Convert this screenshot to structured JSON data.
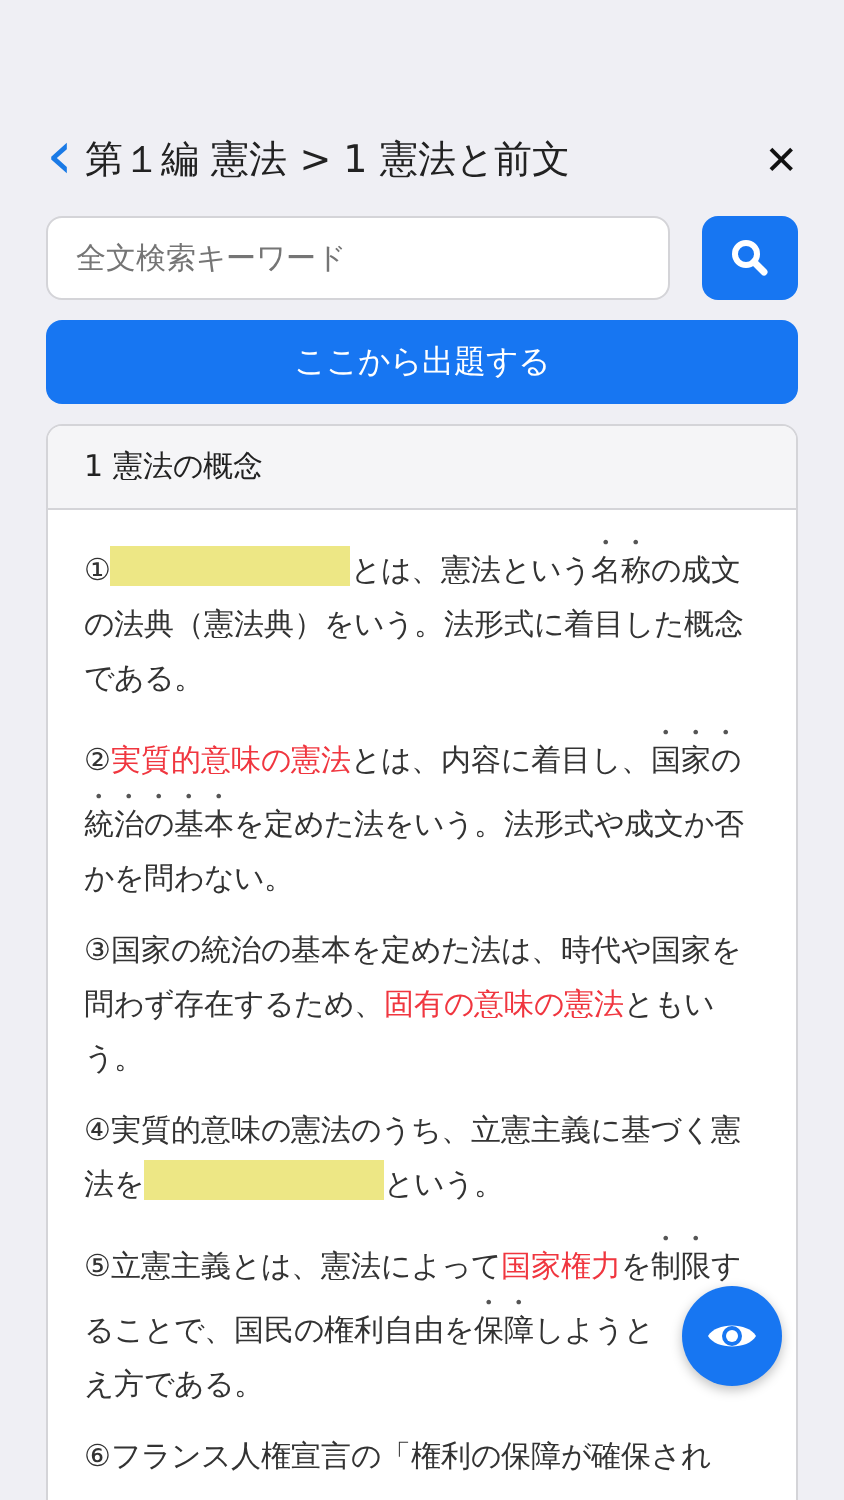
{
  "header": {
    "back": "‹",
    "title": "第１編 憲法 > 1 憲法と前文",
    "close": "✕"
  },
  "search": {
    "placeholder": "全文検索キーワード"
  },
  "start_button": "ここから出題する",
  "section": {
    "title": "1 憲法の概念",
    "paragraphs": [
      {
        "kind": "start",
        "segments": [
          {
            "kind": "text",
            "text": "①"
          },
          {
            "kind": "blank"
          },
          {
            "kind": "text",
            "text": "とは、憲法という"
          },
          {
            "kind": "dot",
            "text": "名称"
          },
          {
            "kind": "text",
            "text": "の成文の法典（憲法典）をいう。法形式に着目した概念である。"
          }
        ]
      },
      {
        "kind": "start",
        "segments": [
          {
            "kind": "text",
            "text": "②"
          },
          {
            "kind": "red",
            "text": "実質的意味の憲法"
          },
          {
            "kind": "text",
            "text": "とは、内容に着目し、"
          },
          {
            "kind": "dot",
            "text": "国家の統治の基本"
          },
          {
            "kind": "text",
            "text": "を定めた法をいう。法形式や成文か否かを問わない。"
          }
        ]
      },
      {
        "kind": "start",
        "segments": [
          {
            "kind": "text",
            "text": "③国家の統治の基本を定めた法は、時代や国家を問わず存在するため、"
          },
          {
            "kind": "red",
            "text": "固有の意味の憲法"
          },
          {
            "kind": "text",
            "text": "ともいう。"
          }
        ]
      },
      {
        "kind": "start",
        "segments": [
          {
            "kind": "text",
            "text": "④実質的意味の憲法のうち、立憲主義に基づく憲法を"
          },
          {
            "kind": "blank"
          },
          {
            "kind": "text",
            "text": "という。"
          }
        ]
      },
      {
        "kind": "start",
        "segments": [
          {
            "kind": "text",
            "text": "⑤立憲主義とは、憲法によって"
          },
          {
            "kind": "red",
            "text": "国家権力"
          },
          {
            "kind": "text",
            "text": "を"
          },
          {
            "kind": "dot",
            "text": "制限"
          },
          {
            "kind": "text",
            "text": "す"
          }
        ]
      },
      {
        "kind": "continuation",
        "segments": [
          {
            "kind": "text",
            "text": "ることで、国民の権利自由を"
          },
          {
            "kind": "dot",
            "text": "保障"
          },
          {
            "kind": "text",
            "text": "しようと"
          }
        ]
      },
      {
        "kind": "continuation",
        "segments": [
          {
            "kind": "text",
            "text": "え方である。"
          }
        ]
      },
      {
        "kind": "start",
        "segments": [
          {
            "kind": "text",
            "text": "⑥フランス人権宣言の「権利の保障が確保され"
          }
        ]
      }
    ]
  }
}
